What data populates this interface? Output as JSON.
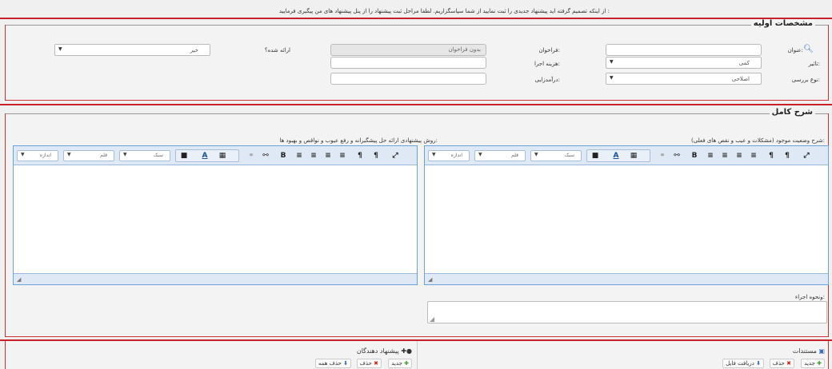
{
  "notice": "از اینکه تصمیم گرفته اید پیشنهاد جدیدی را ثبت نمایید از شما سپاسگزاریم. لطفا مراحل ثبت پیشنهاد را از پنل پیشنهاد های من پیگیری فرمایید :",
  "section_basic": {
    "legend": "مشخصات اولیه",
    "title_label": "عنوان:",
    "title_value": "",
    "impact_label": "تاثیر:",
    "impact_value": "کمی",
    "review_type_label": "نوع بررسی:",
    "review_type_value": "اصلاحی",
    "call_label": "فراخوان:",
    "call_value": "بدون فراخوان",
    "exec_cost_label": "هزینه اجرا:",
    "exec_cost_value": "",
    "revenue_label": "درآمدزایی:",
    "revenue_value": "",
    "presented_label": "ارائه شده؟",
    "presented_value": "خیر"
  },
  "section_full": {
    "legend": "شرح کامل",
    "current_state_label": "شرح وضعیت موجود (مشکلات و عیب و نقص های فعلی):",
    "proposed_method_label": "روش پیشنهادی ارائه حل پیشگیرانه و رفع عیوب و نواقص و بهبود ها:",
    "execution_label": "ونحوه اجراء:"
  },
  "editor_toolbar": {
    "size": "اندازه",
    "font": "قلم",
    "style": "سبک"
  },
  "documents": {
    "title": "مستندات",
    "new": "جدید",
    "delete": "حذف",
    "download": "دریافت فایل"
  },
  "proposers": {
    "title": "پیشنهاد دهندگان",
    "new": "جدید",
    "delete": "حذف",
    "delete_all": "حذف همه"
  },
  "colors": {
    "accent_red": "#c8202a",
    "editor_border": "#6aa3d8"
  }
}
